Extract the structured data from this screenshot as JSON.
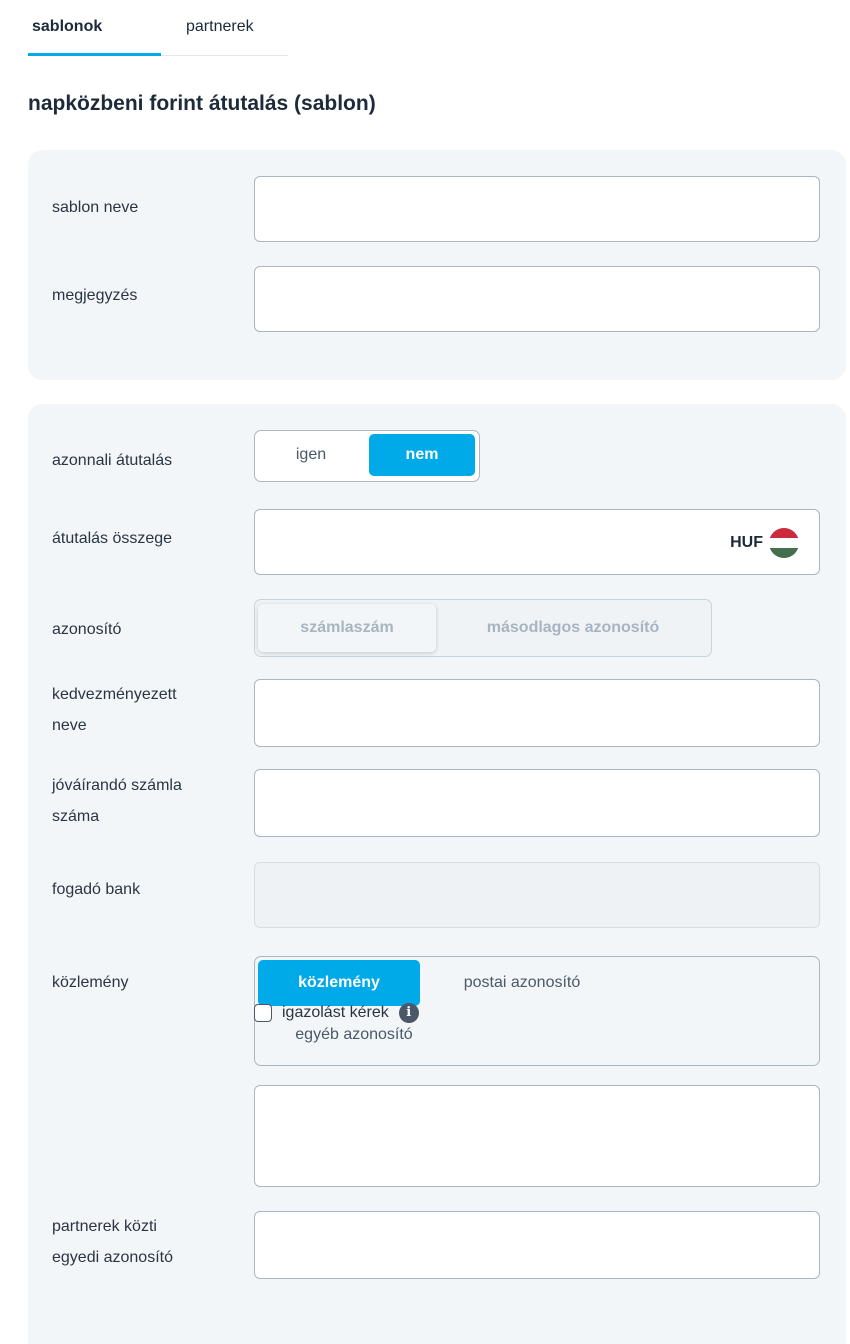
{
  "tabs": [
    {
      "label": "sablonok",
      "active": true
    },
    {
      "label": "partnerek",
      "active": false
    }
  ],
  "page_title": "napközbeni forint átutalás (sablon)",
  "template_section": {
    "name_label": "sablon neve",
    "note_label": "megjegyzés"
  },
  "transfer_section": {
    "instant_label": "azonnali átutalás",
    "instant_options": [
      "igen",
      "nem"
    ],
    "instant_selected": "nem",
    "amount_label": "átutalás összege",
    "currency": "HUF",
    "identifier_label": "azonosító",
    "identifier_options": [
      "számlaszám",
      "másodlagos azonosító"
    ],
    "beneficiary_label_line1": "kedvezményezett",
    "beneficiary_label_line2": "neve",
    "account_label_line1": "jóváírandó számla",
    "account_label_line2": "száma",
    "bank_label": "fogadó bank",
    "remittance_label": "közlemény",
    "remittance_options": [
      "közlemény",
      "postai azonosító",
      "egyéb azonosító"
    ],
    "remittance_selected": "közlemény",
    "partner_id_label_line1": "partnerek közti",
    "partner_id_label_line2": "egyedi azonosító",
    "confirmation_label": "igazolást kérek"
  },
  "colors": {
    "accent": "#00a9e8",
    "card_bg": "#f3f6f9",
    "flag_red": "#cd2a3e",
    "flag_white": "#ffffff",
    "flag_green": "#436f4d"
  }
}
